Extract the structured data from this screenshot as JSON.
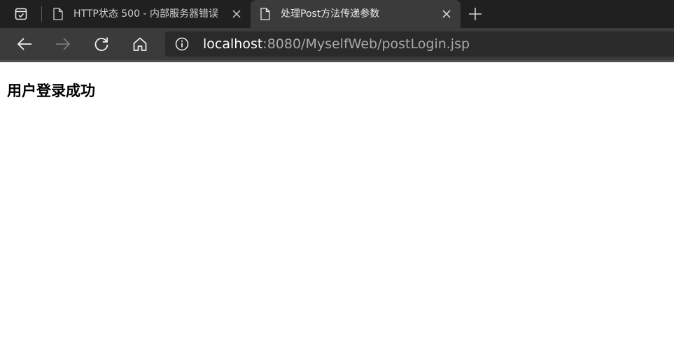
{
  "tabs": [
    {
      "title": "HTTP状态 500 - 内部服务器错误",
      "active": false
    },
    {
      "title": "处理Post方法传递参数",
      "active": true
    }
  ],
  "address": {
    "host": "localhost",
    "rest": ":8080/MyselfWeb/postLogin.jsp"
  },
  "page": {
    "heading": "用户登录成功"
  },
  "icons": {
    "tab_actions": "tab-actions-icon",
    "page": "page-icon",
    "close": "close-icon",
    "new_tab": "plus-icon",
    "back": "arrow-left-icon",
    "forward": "arrow-right-icon",
    "refresh": "refresh-icon",
    "home": "home-icon",
    "info": "info-icon"
  },
  "colors": {
    "tabstrip": "#202020",
    "toolbar": "#3b3b3b",
    "address_bg": "#2a2a2a",
    "url_host": "#ffffff",
    "url_rest": "#a9a9a9"
  }
}
